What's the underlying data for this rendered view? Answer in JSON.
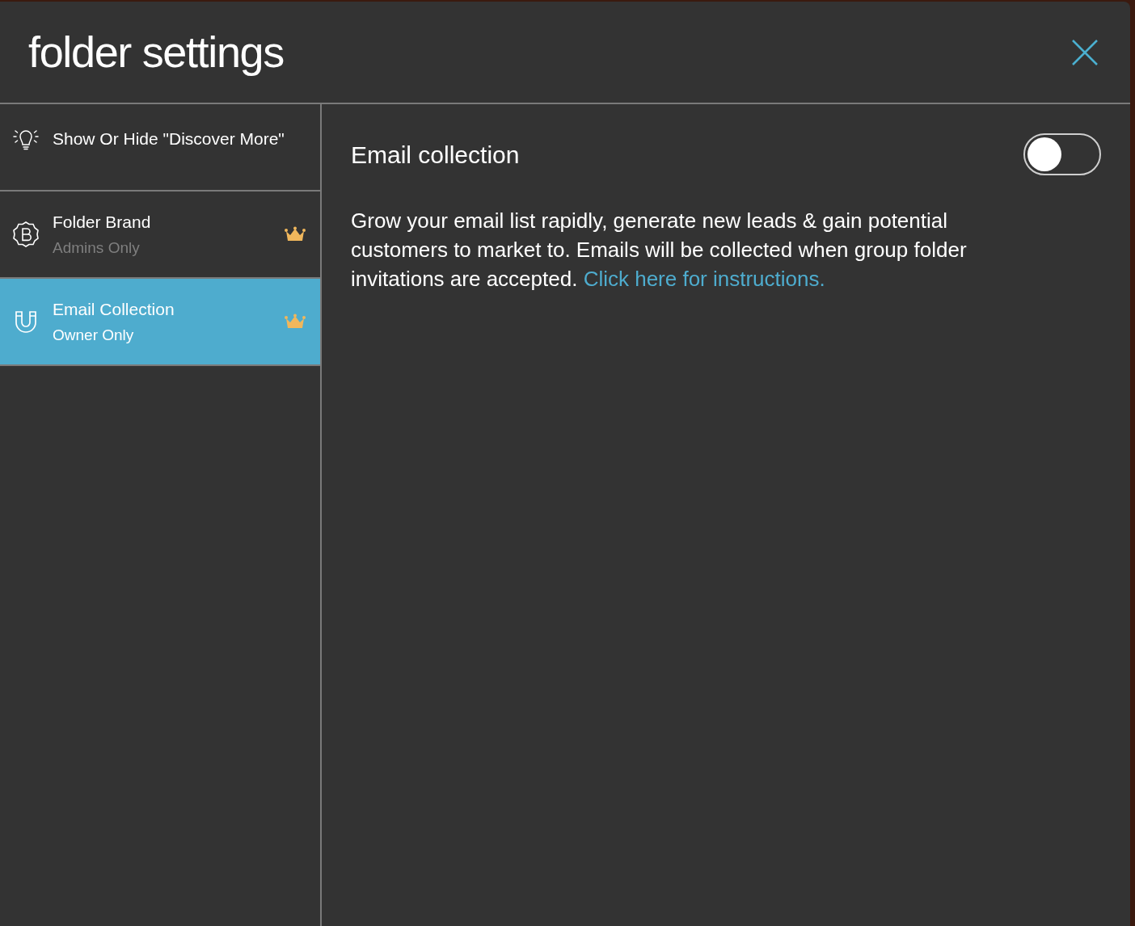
{
  "dialog": {
    "title": "folder settings"
  },
  "sidebar": {
    "items": [
      {
        "label": "Show Or Hide \"Discover More\"",
        "selected": false,
        "premium": false
      },
      {
        "label": "Folder Brand",
        "subtitle": "Admins Only",
        "selected": false,
        "premium": true
      },
      {
        "label": "Email Collection",
        "subtitle": "Owner Only",
        "selected": true,
        "premium": true
      }
    ]
  },
  "panel": {
    "heading": "Email collection",
    "toggle": {
      "on": false
    },
    "description": "Grow your email list rapidly, generate new leads & gain potential customers to market to. Emails will be collected when group folder invitations are accepted.",
    "link": "Click here for instructions."
  }
}
